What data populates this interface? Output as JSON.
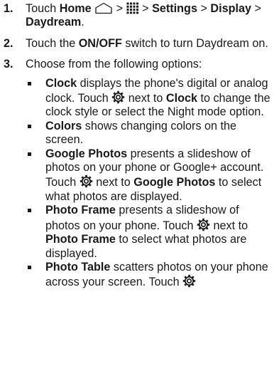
{
  "steps": [
    {
      "num": "1.",
      "parts": {
        "touch": "Touch ",
        "home": "Home",
        "sep1": " > ",
        "sep2": " > ",
        "settings": "Settings",
        "sep3": " > ",
        "display": "Display",
        "sep4": " > ",
        "daydream": "Daydream",
        "end": "."
      }
    },
    {
      "num": "2.",
      "parts": {
        "touch": "Touch the ",
        "onoff": "ON/OFF",
        "rest": " switch to turn Daydream on."
      }
    },
    {
      "num": "3.",
      "text": "Choose from the following options:"
    }
  ],
  "options": [
    {
      "name": "Clock",
      "desc1": " displays the phone's digital or analog clock. Touch ",
      "desc2": " next to ",
      "name2": "Clock",
      "desc3": " to change the clock style or select the Night mode option."
    },
    {
      "name": "Colors",
      "desc1": " shows changing colors on the screen."
    },
    {
      "name": "Google Photos",
      "desc1": " presents a slideshow of photos on your phone or Google+ account. Touch ",
      "desc2": " next to ",
      "name2": "Google Photos",
      "desc3": " to select what photos are displayed."
    },
    {
      "name": "Photo Frame",
      "desc1": " presents a slideshow of photos on your phone. Touch ",
      "desc2": " next to ",
      "name2": "Photo Frame",
      "desc3": " to select what photos are displayed."
    },
    {
      "name": "Photo Table",
      "desc1": " scatters photos on your phone across your screen. Touch "
    }
  ],
  "icons": {
    "home": "home-icon",
    "apps": "all-apps-grid-icon",
    "settings": "gear-icon"
  }
}
